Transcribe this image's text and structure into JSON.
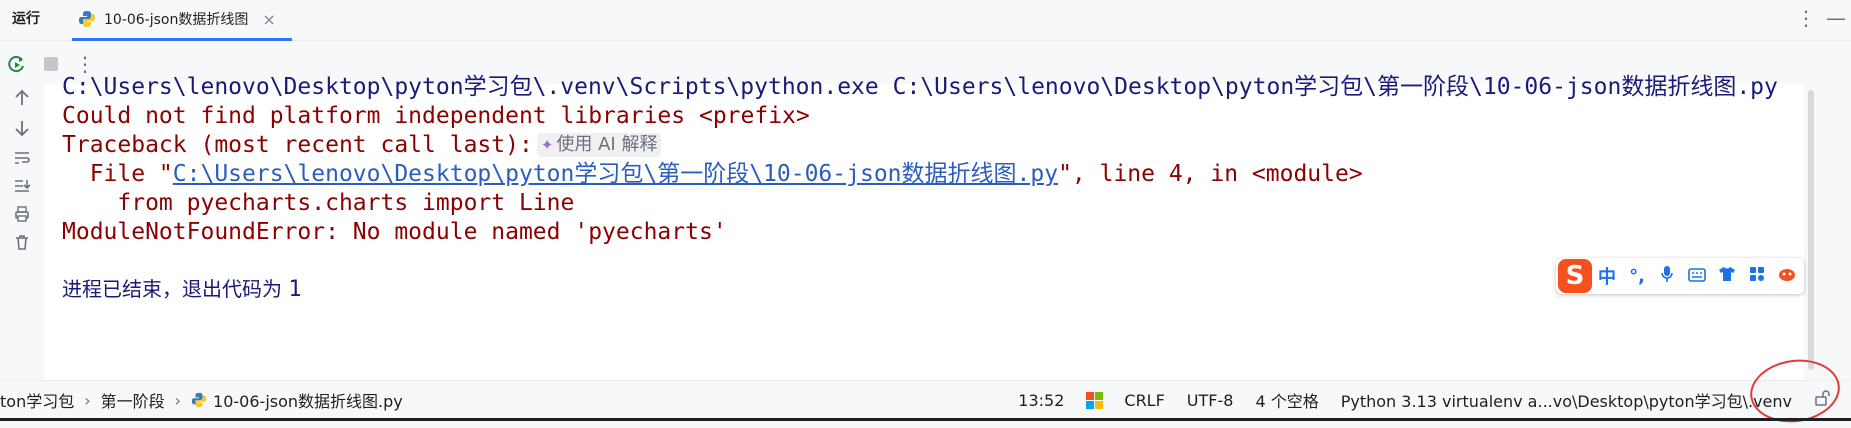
{
  "header": {
    "run_label": "运行",
    "tab_title": "10-06-json数据折线图",
    "tab_close": "×"
  },
  "console": {
    "line1": "C:\\Users\\lenovo\\Desktop\\pyton学习包\\.venv\\Scripts\\python.exe C:\\Users\\lenovo\\Desktop\\pyton学习包\\第一阶段\\10-06-json数据折线图.py",
    "line2": "Could not find platform independent libraries <prefix>",
    "line3": "Traceback (most recent call last):",
    "ai_explain": "使用 AI 解释",
    "line4_prefix": "  File \"",
    "line4_link": "C:\\Users\\lenovo\\Desktop\\pyton学习包\\第一阶段\\10-06-json数据折线图.py",
    "line4_suffix": "\", line 4, in <module>",
    "line5": "    from pyecharts.charts import Line",
    "line6": "ModuleNotFoundError: No module named 'pyecharts'",
    "exit_text": "进程已结束，退出代码为 ",
    "exit_code": "1"
  },
  "ime": {
    "logo": "S",
    "items": [
      "中",
      "°,"
    ]
  },
  "status": {
    "crumbs": [
      "ton学习包",
      "第一阶段",
      "10-06-json数据折线图.py"
    ],
    "time": "13:52",
    "line_ending": "CRLF",
    "encoding": "UTF-8",
    "indent": "4 个空格",
    "interpreter": "Python 3.13 virtualenv a...vo\\Desktop\\pyton学习包\\.venv"
  },
  "colors": {
    "accent": "#3574f0",
    "error_text": "#8b0000",
    "command_text": "#1a1a7a",
    "link": "#2a5dbf"
  }
}
